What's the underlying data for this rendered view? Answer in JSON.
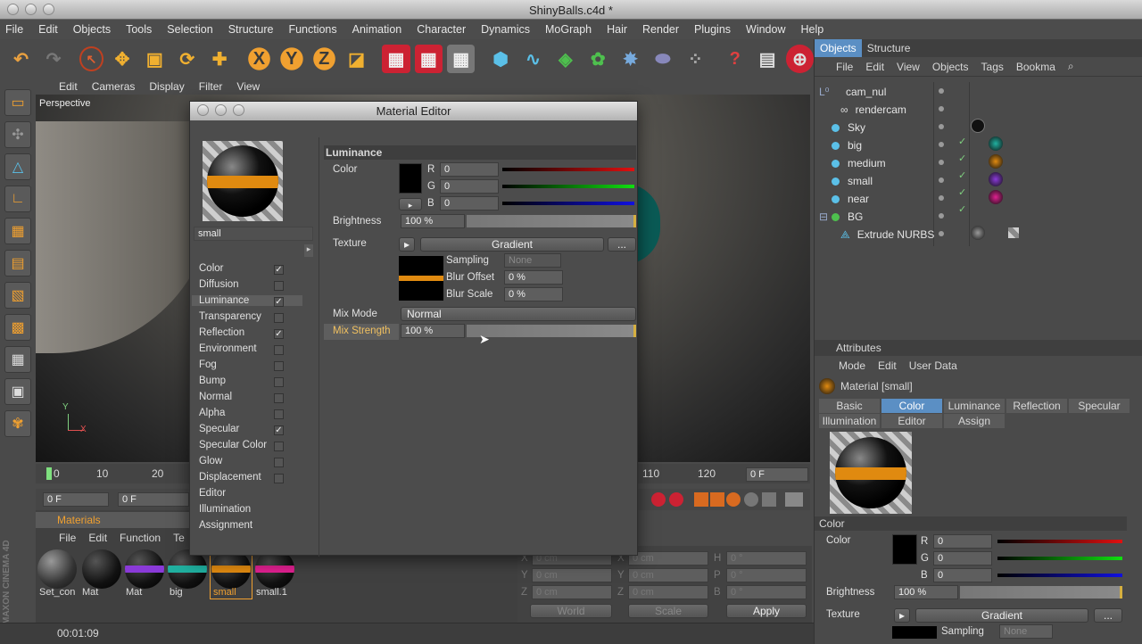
{
  "window": {
    "title": "ShinyBalls.c4d *"
  },
  "menubar": [
    "File",
    "Edit",
    "Objects",
    "Tools",
    "Selection",
    "Structure",
    "Functions",
    "Animation",
    "Character",
    "Dynamics",
    "MoGraph",
    "Hair",
    "Render",
    "Plugins",
    "Window",
    "Help"
  ],
  "toolbar": {
    "x": "X",
    "y": "Y",
    "z": "Z"
  },
  "viewport": {
    "menu": [
      "Edit",
      "Cameras",
      "Display",
      "Filter",
      "View"
    ],
    "label": "Perspective",
    "axis_y": "Y",
    "axis_x": "X"
  },
  "timeline": {
    "ticks": [
      "0",
      "10",
      "20",
      "110",
      "120"
    ],
    "frame_field": "0 F",
    "start_field": "0 F",
    "start_field2": "0 F"
  },
  "materials": {
    "title": "Materials",
    "menu": [
      "File",
      "Edit",
      "Function",
      "Te"
    ],
    "items": [
      {
        "label": "Set_con"
      },
      {
        "label": "Mat"
      },
      {
        "label": "Mat"
      },
      {
        "label": "big"
      },
      {
        "label": "small"
      },
      {
        "label": "small.1"
      }
    ]
  },
  "coords": {
    "rows": [
      {
        "a": "X",
        "av": "0 cm",
        "b": "X",
        "bv": "0 cm",
        "c": "H",
        "cv": "0 °"
      },
      {
        "a": "Y",
        "av": "0 cm",
        "b": "Y",
        "bv": "0 cm",
        "c": "P",
        "cv": "0 °"
      },
      {
        "a": "Z",
        "av": "0 cm",
        "b": "Z",
        "bv": "0 cm",
        "c": "B",
        "cv": "0 °"
      }
    ],
    "world": "World",
    "scale": "Scale",
    "apply": "Apply"
  },
  "status": {
    "time": "00:01:09"
  },
  "brand": "MAXON CINEMA 4D",
  "objects_panel": {
    "tabs": [
      "Objects",
      "Structure"
    ],
    "menu": [
      "File",
      "Edit",
      "View",
      "Objects",
      "Tags",
      "Bookma"
    ],
    "items": [
      {
        "name": "cam_nul"
      },
      {
        "name": "rendercam"
      },
      {
        "name": "Sky"
      },
      {
        "name": "big"
      },
      {
        "name": "medium"
      },
      {
        "name": "small"
      },
      {
        "name": "near"
      },
      {
        "name": "BG"
      },
      {
        "name": "Extrude NURBS"
      }
    ]
  },
  "attributes": {
    "title": "Attributes",
    "menu": [
      "Mode",
      "Edit",
      "User Data"
    ],
    "material": "Material [small]",
    "tabs_row1": [
      "Basic",
      "Color",
      "Luminance",
      "Reflection",
      "Specular"
    ],
    "tabs_row2": [
      "Illumination",
      "Editor",
      "Assign"
    ],
    "section": "Color",
    "color_label": "Color",
    "r": "0",
    "g": "0",
    "b": "0",
    "brightness_label": "Brightness",
    "brightness": "100 %",
    "texture_label": "Texture",
    "texture_btn": "Gradient",
    "texture_more": "...",
    "sampling_label": "Sampling",
    "sampling": "None"
  },
  "material_editor": {
    "title": "Material Editor",
    "name": "small",
    "channels": [
      {
        "label": "Color",
        "checked": true
      },
      {
        "label": "Diffusion",
        "checked": false
      },
      {
        "label": "Luminance",
        "checked": true
      },
      {
        "label": "Transparency",
        "checked": false
      },
      {
        "label": "Reflection",
        "checked": true
      },
      {
        "label": "Environment",
        "checked": false
      },
      {
        "label": "Fog",
        "checked": false
      },
      {
        "label": "Bump",
        "checked": false
      },
      {
        "label": "Normal",
        "checked": false
      },
      {
        "label": "Alpha",
        "checked": false
      },
      {
        "label": "Specular",
        "checked": true
      },
      {
        "label": "Specular Color",
        "checked": false
      },
      {
        "label": "Glow",
        "checked": false
      },
      {
        "label": "Displacement",
        "checked": false
      },
      {
        "label": "Editor",
        "checked": null
      },
      {
        "label": "Illumination",
        "checked": null
      },
      {
        "label": "Assignment",
        "checked": null
      }
    ],
    "section": "Luminance",
    "color_label": "Color",
    "r": "0",
    "g": "0",
    "b": "0",
    "brightness_label": "Brightness",
    "brightness": "100 %",
    "texture_label": "Texture",
    "texture_btn": "Gradient",
    "texture_more": "...",
    "sampling_label": "Sampling",
    "sampling": "None",
    "blur_offset_label": "Blur Offset",
    "blur_offset": "0 %",
    "blur_scale_label": "Blur Scale",
    "blur_scale": "0 %",
    "mix_mode_label": "Mix Mode",
    "mix_mode": "Normal",
    "mix_strength_label": "Mix Strength",
    "mix_strength": "100 %"
  },
  "colors": {
    "accent_blue": "#5b8fc4",
    "orange": "#e08a10"
  }
}
